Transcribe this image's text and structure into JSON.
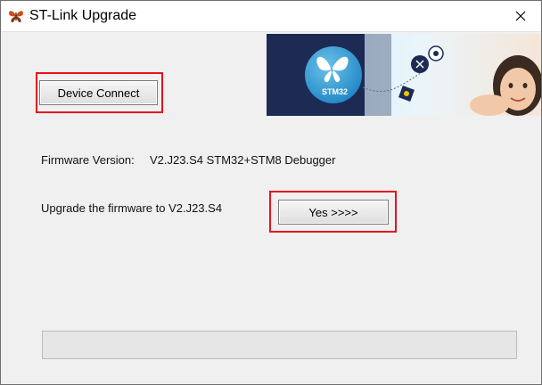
{
  "window": {
    "title": "ST-Link Upgrade",
    "app_icon": "butterfly-icon",
    "close_icon": "close-icon"
  },
  "banner": {
    "brand_text": "STM32",
    "image": "stm32-promo-banner"
  },
  "buttons": {
    "device_connect": "Device Connect",
    "yes": "Yes >>>>"
  },
  "firmware": {
    "label": "Firmware Version:",
    "value": "V2.J23.S4 STM32+STM8 Debugger"
  },
  "upgrade": {
    "text": "Upgrade the firmware to V2.J23.S4"
  },
  "progress": {
    "fraction": 0
  },
  "colors": {
    "highlight": "#e8131f",
    "banner_navy": "#1c2a54",
    "stm_blue": "#3aa0d6"
  }
}
